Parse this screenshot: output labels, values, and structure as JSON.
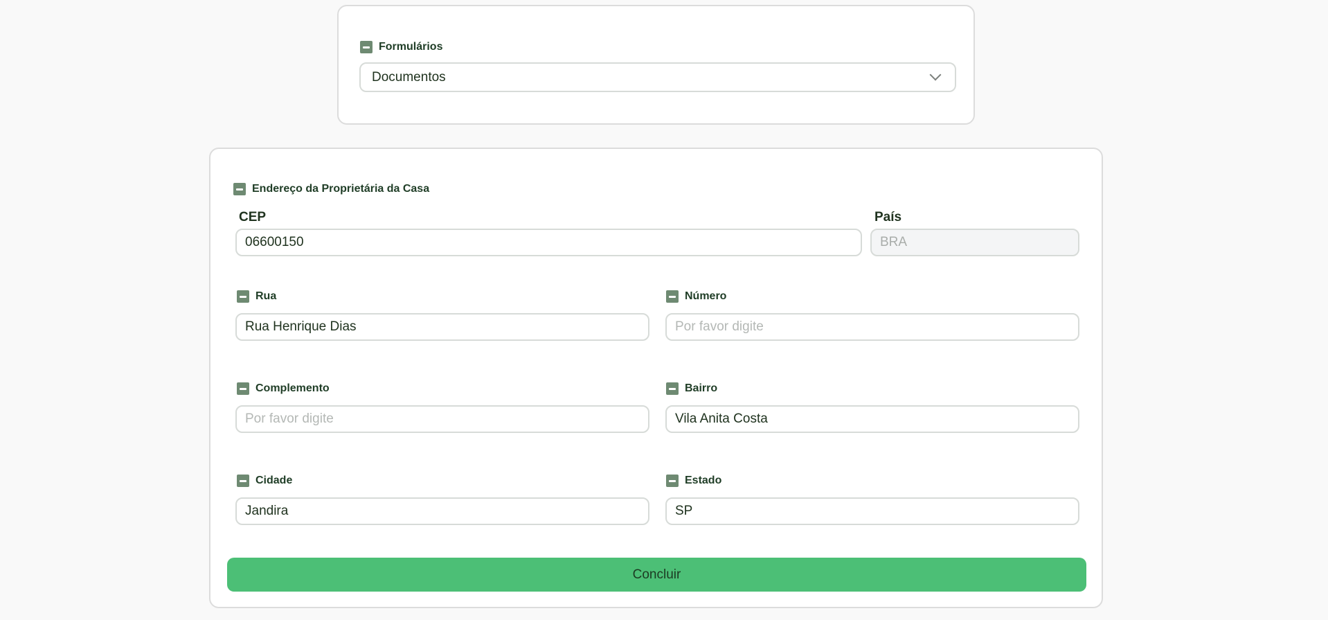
{
  "forms_section": {
    "label": "Formulários",
    "selected": "Documentos"
  },
  "address_section": {
    "title": "Endereço da Proprietária da Casa",
    "cep": {
      "label": "CEP",
      "value": "06600150"
    },
    "pais": {
      "label": "País",
      "value": "BRA"
    },
    "rua": {
      "label": "Rua",
      "value": "Rua Henrique Dias"
    },
    "numero": {
      "label": "Número",
      "placeholder": "Por favor digite"
    },
    "complemento": {
      "label": "Complemento",
      "placeholder": "Por favor digite"
    },
    "bairro": {
      "label": "Bairro",
      "value": "Vila Anita Costa"
    },
    "cidade": {
      "label": "Cidade",
      "value": "Jandira"
    },
    "estado": {
      "label": "Estado",
      "value": "SP"
    }
  },
  "submit": {
    "label": "Concluir"
  },
  "colors": {
    "accent": "#4cbf76",
    "icon": "#6e8a72",
    "text": "#1f3d26"
  },
  "icons": {
    "section_toggle": "minus-square-icon",
    "dropdown": "chevron-down-icon"
  }
}
